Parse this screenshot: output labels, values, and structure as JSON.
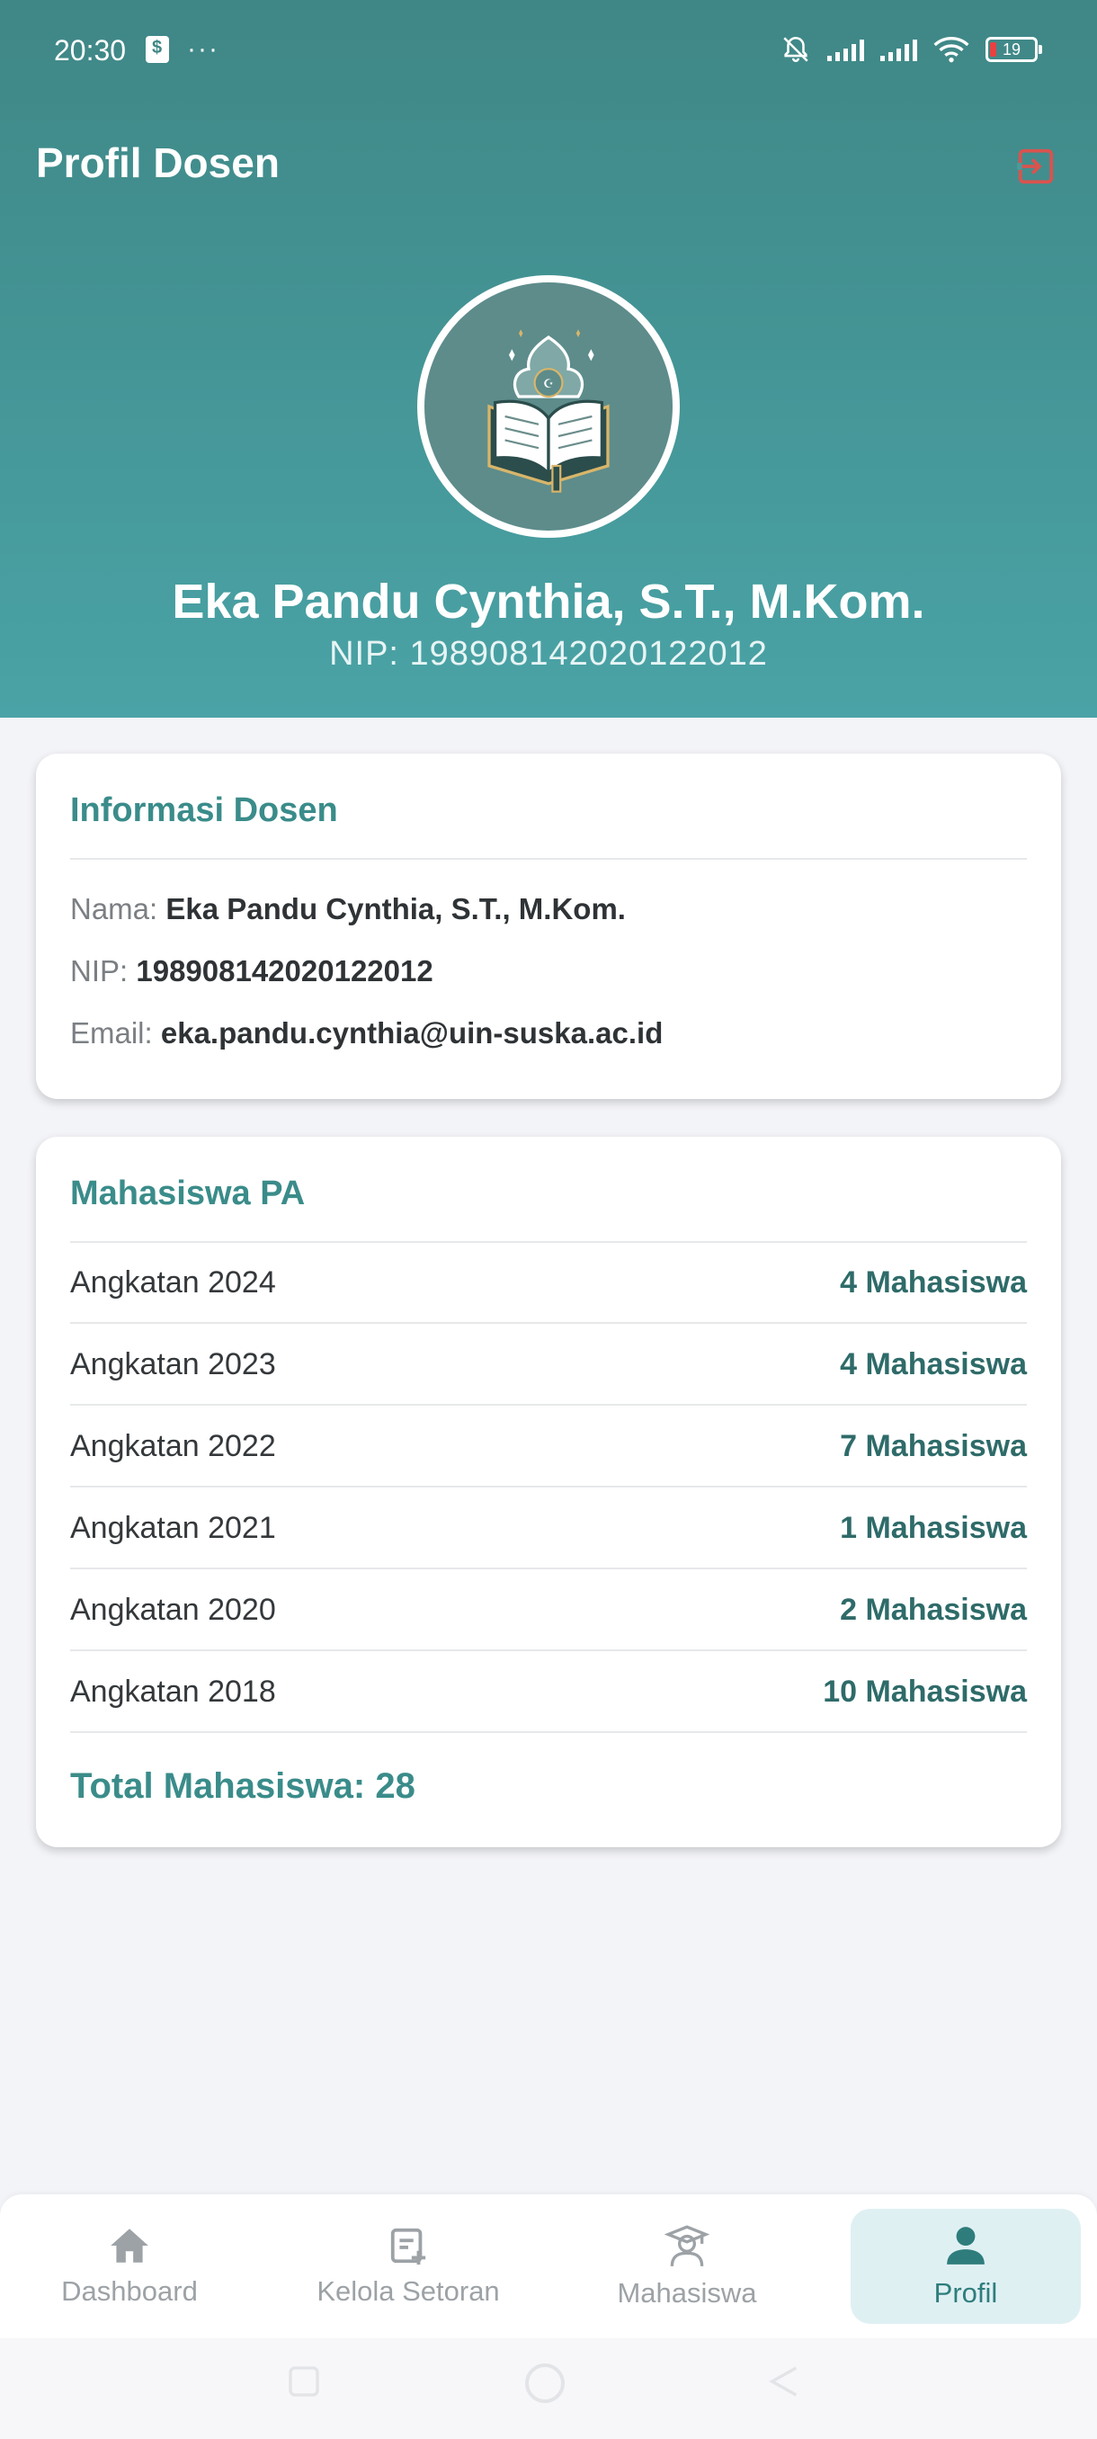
{
  "status": {
    "time": "20:30",
    "battery": "19"
  },
  "header": {
    "title": "Profil Dosen",
    "name": "Eka Pandu Cynthia, S.T., M.Kom.",
    "nip_line": "NIP: 198908142020122012"
  },
  "info_card": {
    "title": "Informasi Dosen",
    "nama_label": "Nama:",
    "nama_value": "Eka Pandu Cynthia, S.T., M.Kom.",
    "nip_label": "NIP:",
    "nip_value": "198908142020122012",
    "email_label": "Email:",
    "email_value": "eka.pandu.cynthia@uin-suska.ac.id"
  },
  "pa_card": {
    "title": "Mahasiswa PA",
    "rows": [
      {
        "label": "Angkatan 2024",
        "count": "4 Mahasiswa"
      },
      {
        "label": "Angkatan 2023",
        "count": "4 Mahasiswa"
      },
      {
        "label": "Angkatan 2022",
        "count": "7 Mahasiswa"
      },
      {
        "label": "Angkatan 2021",
        "count": "1 Mahasiswa"
      },
      {
        "label": "Angkatan 2020",
        "count": "2 Mahasiswa"
      },
      {
        "label": "Angkatan 2018",
        "count": "10 Mahasiswa"
      }
    ],
    "total": "Total Mahasiswa: 28"
  },
  "nav": {
    "items": [
      {
        "label": "Dashboard",
        "icon": "home-icon"
      },
      {
        "label": "Kelola Setoran",
        "icon": "edit-note-icon"
      },
      {
        "label": "Mahasiswa",
        "icon": "student-icon"
      },
      {
        "label": "Profil",
        "icon": "person-icon"
      }
    ],
    "active": "Profil"
  },
  "colors": {
    "header_top": "#3f8786",
    "header_bottom": "#4aa3a6",
    "accent": "#3a8c8a",
    "logout": "#d9534f",
    "nav_active_bg": "#dff0f3"
  }
}
